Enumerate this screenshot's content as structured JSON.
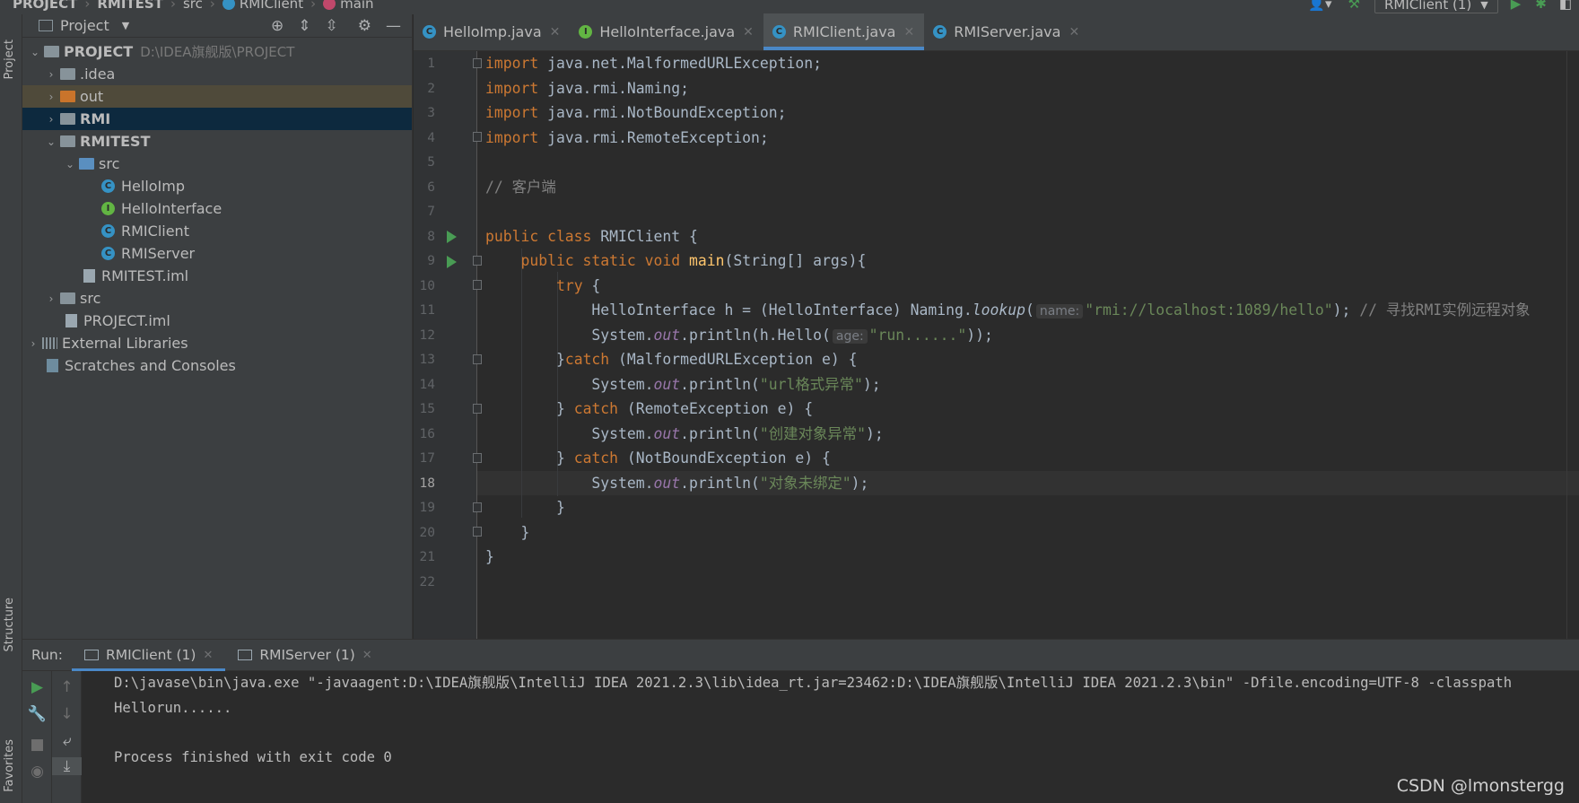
{
  "navbar": {
    "crumbs": [
      "PROJECT",
      "RMITEST",
      "src",
      "RMIClient",
      "main"
    ],
    "run_config": "RMIClient (1)"
  },
  "left_stripe": {
    "project_tab": "Project",
    "structure_tab": "Structure",
    "favorites_tab": "Favorites"
  },
  "project_panel": {
    "header": "Project",
    "tree": [
      {
        "label": "PROJECT",
        "path": "D:\\IDEA旗舰版\\PROJECT"
      },
      {
        "label": ".idea"
      },
      {
        "label": "out"
      },
      {
        "label": "RMI"
      },
      {
        "label": "RMITEST"
      },
      {
        "label": "src"
      },
      {
        "label": "HelloImp"
      },
      {
        "label": "HelloInterface"
      },
      {
        "label": "RMIClient"
      },
      {
        "label": "RMIServer"
      },
      {
        "label": "RMITEST.iml"
      },
      {
        "label": "src"
      },
      {
        "label": "PROJECT.iml"
      },
      {
        "label": "External Libraries"
      },
      {
        "label": "Scratches and Consoles"
      }
    ]
  },
  "editor_tabs": [
    {
      "label": "HelloImp.java"
    },
    {
      "label": "HelloInterface.java"
    },
    {
      "label": "RMIClient.java"
    },
    {
      "label": "RMIServer.java"
    }
  ],
  "code": {
    "line_numbers": [
      "1",
      "2",
      "3",
      "4",
      "5",
      "6",
      "7",
      "8",
      "9",
      "10",
      "11",
      "12",
      "13",
      "14",
      "15",
      "16",
      "17",
      "18",
      "19",
      "20",
      "21",
      "22"
    ],
    "l1": {
      "kw": "import",
      "rest": " java.net.MalformedURLException;"
    },
    "l2": {
      "kw": "import",
      "rest": " java.rmi.Naming;"
    },
    "l3": {
      "kw": "import",
      "rest": " java.rmi.NotBoundException;"
    },
    "l4": {
      "kw": "import",
      "rest": " java.rmi.RemoteException;"
    },
    "l6": {
      "comment": "// 客户端"
    },
    "l8": {
      "kw": "public class",
      "rest": " RMIClient {"
    },
    "l9": {
      "kw": "public static void",
      "fn": "main",
      "rest": "(String[] args){"
    },
    "l10": {
      "kw": "try",
      "rest": " {"
    },
    "l11": {
      "pre": "HelloInterface h = (HelloInterface) Naming.",
      "method": "lookup",
      "open": "(",
      "hint": "name:",
      "str": "\"rmi://localhost:1089/hello\"",
      "close": ");",
      "comment": "// 寻找RMI实例远程对象"
    },
    "l12": {
      "pre": "System.",
      "field": "out",
      "mid": ".println(h.Hello(",
      "hint": "age:",
      "str": "\"run......\"",
      "close": "));"
    },
    "l13": {
      "pre": "}",
      "kw": "catch",
      "rest": " (MalformedURLException e) {"
    },
    "l14": {
      "pre": "System.",
      "field": "out",
      "mid": ".println(",
      "str": "\"url格式异常\"",
      "close": ");"
    },
    "l15": {
      "pre": "} ",
      "kw": "catch",
      "rest": " (RemoteException e) {"
    },
    "l16": {
      "pre": "System.",
      "field": "out",
      "mid": ".println(",
      "str": "\"创建对象异常\"",
      "close": ");"
    },
    "l17": {
      "pre": "} ",
      "kw": "catch",
      "rest": " (NotBoundException e) {"
    },
    "l18": {
      "pre": "System.",
      "field": "out",
      "mid": ".println(",
      "str": "\"对象未绑定\"",
      "close": ");"
    },
    "l19": {
      "text": "}"
    },
    "l20": {
      "text": "}"
    },
    "l21": {
      "text": "}"
    }
  },
  "run_panel": {
    "label": "Run:",
    "tabs": [
      {
        "label": "RMIClient (1)"
      },
      {
        "label": "RMIServer (1)"
      }
    ],
    "console": [
      "D:\\javase\\bin\\java.exe \"-javaagent:D:\\IDEA旗舰版\\IntelliJ IDEA 2021.2.3\\lib\\idea_rt.jar=23462:D:\\IDEA旗舰版\\IntelliJ IDEA 2021.2.3\\bin\" -Dfile.encoding=UTF-8 -classpath",
      "Hellorun......",
      "",
      "Process finished with exit code 0"
    ]
  },
  "watermark": "CSDN @lmonstergg",
  "colors": {
    "background": "#2b2b2b",
    "panel": "#3c3f41",
    "keyword": "#cc7832",
    "string": "#6a8759",
    "function": "#ffc66d",
    "static_field": "#9876aa",
    "comment": "#808080",
    "accent": "#4a88c7",
    "run_green": "#499c54",
    "selection": "#0d293e"
  }
}
